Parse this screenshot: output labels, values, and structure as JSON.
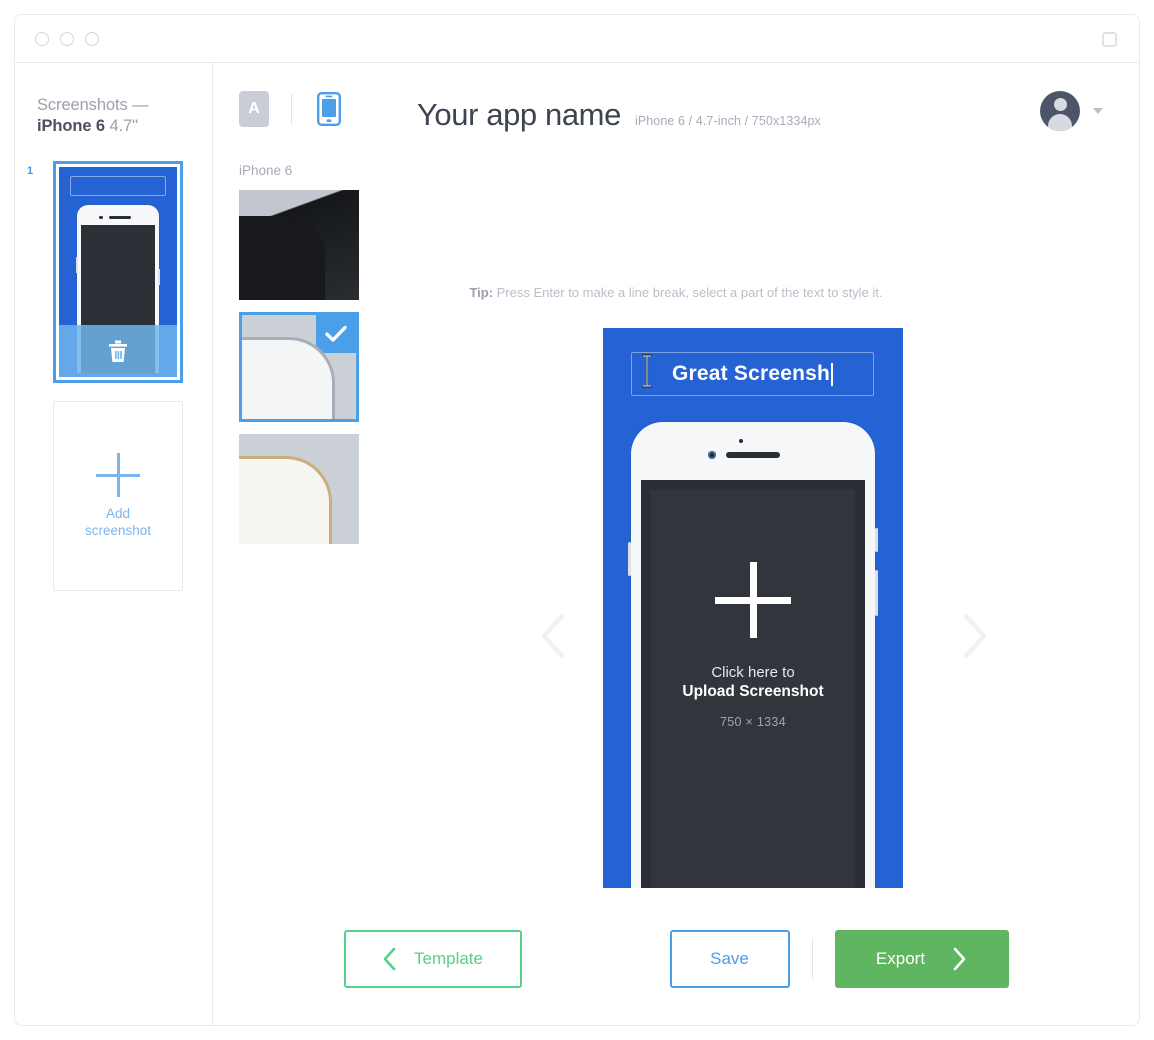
{
  "window": {
    "traffic_dots": 3,
    "maximize_icon": "maximize-square-icon"
  },
  "sidebar": {
    "title_line1": "Screenshots —",
    "device_strong": "iPhone 6",
    "device_size": "4.7\"",
    "screenshots": [
      {
        "index": "1",
        "selected": true,
        "delete_icon": "trash-icon"
      }
    ],
    "add_button": {
      "icon": "plus-icon",
      "label_line1": "Add",
      "label_line2": "screenshot"
    }
  },
  "toolbar": {
    "text_tool": {
      "icon": "text-tool-icon",
      "label": "A",
      "active": false
    },
    "device_tool": {
      "icon": "device-phone-icon",
      "active": true
    }
  },
  "header": {
    "app_title": "Your app name",
    "subtitle": "iPhone 6 / 4.7-inch / 750x1334px",
    "account": {
      "avatar_icon": "user-avatar-icon",
      "caret_icon": "chevron-down-icon"
    }
  },
  "device_panel": {
    "label": "iPhone 6",
    "swatches": [
      {
        "name": "black",
        "selected": false
      },
      {
        "name": "silver",
        "selected": true,
        "check_icon": "check-icon"
      },
      {
        "name": "gold",
        "selected": false
      }
    ]
  },
  "tip": {
    "prefix": "Tip:",
    "text": " Press Enter to make a line break, select a part of the text to style it."
  },
  "canvas": {
    "background_color": "#2563d4",
    "caption_text": "Great Screensh",
    "cursor_icon": "text-ibeam-cursor",
    "upload": {
      "plus_icon": "plus-icon",
      "line1": "Click here to",
      "line2": "Upload Screenshot",
      "dimensions": "750 × 1334"
    },
    "nav_prev_icon": "chevron-left-icon",
    "nav_next_icon": "chevron-right-icon"
  },
  "footer": {
    "template_button": {
      "label": "Template",
      "icon": "chevron-left-icon",
      "color": "#55d08a"
    },
    "save_button": {
      "label": "Save",
      "color": "#4a9fe8"
    },
    "export_button": {
      "label": "Export",
      "icon": "chevron-right-icon",
      "color": "#60b561"
    }
  }
}
